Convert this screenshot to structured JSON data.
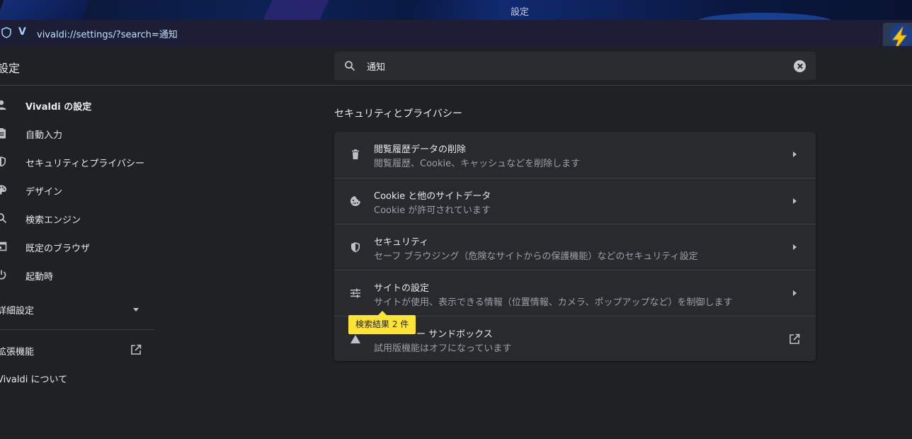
{
  "window": {
    "title": "設定"
  },
  "address_bar": {
    "url": "vivaldi://settings/?search=通知"
  },
  "header": {
    "page_title": "設定",
    "search_value": "通知"
  },
  "sidebar": {
    "items": [
      {
        "label": "Vivaldi の設定",
        "icon": "person-icon"
      },
      {
        "label": "自動入力",
        "icon": "clipboard-icon"
      },
      {
        "label": "セキュリティとプライバシー",
        "icon": "shield-icon"
      },
      {
        "label": "デザイン",
        "icon": "palette-icon"
      },
      {
        "label": "検索エンジン",
        "icon": "search-icon"
      },
      {
        "label": "既定のブラウザ",
        "icon": "browser-window-icon"
      },
      {
        "label": "起動時",
        "icon": "power-icon"
      }
    ],
    "advanced": "詳細設定",
    "extensions": "拡張機能",
    "about": "Vivaldi について"
  },
  "main": {
    "section_title": "セキュリティとプライバシー",
    "rows": [
      {
        "title": "閲覧履歴データの削除",
        "subtitle": "閲覧履歴、Cookie、キャッシュなどを削除します",
        "icon": "trash-icon"
      },
      {
        "title": "Cookie と他のサイトデータ",
        "subtitle": "Cookie が許可されています",
        "icon": "cookie-icon"
      },
      {
        "title": "セキュリティ",
        "subtitle": "セーフ ブラウジング（危険なサイトからの保護機能）などのセキュリティ設定",
        "icon": "shield-icon"
      },
      {
        "title": "サイトの設定",
        "subtitle": "サイトが使用、表示できる情報（位置情報、カメラ、ポップアップなど）を制御します",
        "icon": "sliders-icon"
      },
      {
        "title": "ー サンドボックス",
        "subtitle": "試用版機能はオフになっています",
        "icon": "triangle-icon"
      }
    ],
    "tooltip": "検索結果 2 件"
  },
  "colors": {
    "background": "#202124",
    "card": "#292a2d",
    "highlight": "#fde332",
    "url_text": "#b8e3ff"
  }
}
